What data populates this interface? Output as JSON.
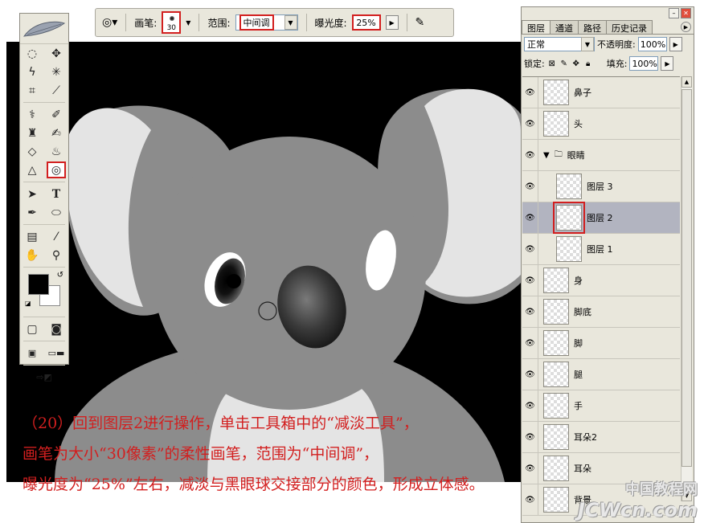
{
  "options_bar": {
    "brush_label": "画笔:",
    "brush_size": "30",
    "range_label": "范围:",
    "range_value": "中间调",
    "exposure_label": "曝光度:",
    "exposure_value": "25%"
  },
  "toolbox": {
    "tools": [
      "marquee-icon",
      "move-icon",
      "lasso-icon",
      "magic-wand-icon",
      "crop-icon",
      "slice-icon",
      "healing-brush-icon",
      "brush-icon",
      "clone-stamp-icon",
      "history-brush-icon",
      "eraser-icon",
      "paint-bucket-icon",
      "blur-icon",
      "dodge-icon",
      "path-select-icon",
      "type-icon",
      "pen-icon",
      "ellipse-shape-icon",
      "notes-icon",
      "eyedropper-icon",
      "hand-icon",
      "zoom-icon"
    ],
    "selected_tool": "dodge-icon",
    "foreground_color": "#000000",
    "background_color": "#ffffff"
  },
  "layers_panel": {
    "tabs": [
      "图层",
      "通道",
      "路径",
      "历史记录"
    ],
    "active_tab": "图层",
    "blend_mode": "正常",
    "opacity_label": "不透明度:",
    "opacity_value": "100%",
    "lock_label": "锁定:",
    "fill_label": "填充:",
    "fill_value": "100%",
    "layers": [
      {
        "name": "鼻子",
        "group_member": false
      },
      {
        "name": "头",
        "group_member": false
      },
      {
        "name": "眼睛",
        "group_member": false,
        "is_group": true
      },
      {
        "name": "图层 3",
        "group_member": true
      },
      {
        "name": "图层 2",
        "group_member": true,
        "selected": true
      },
      {
        "name": "图层 1",
        "group_member": true
      },
      {
        "name": "身",
        "group_member": false
      },
      {
        "name": "脚底",
        "group_member": false
      },
      {
        "name": "脚",
        "group_member": false
      },
      {
        "name": "腿",
        "group_member": false
      },
      {
        "name": "手",
        "group_member": false
      },
      {
        "name": "耳朵2",
        "group_member": false
      },
      {
        "name": "耳朵",
        "group_member": false
      },
      {
        "name": "背景",
        "group_member": false
      }
    ]
  },
  "caption": {
    "line1": "（20）回到图层2进行操作，单击工具箱中的“减淡工具”，",
    "line2": "画笔为大小“30像素”的柔性画笔，范围为“中间调”，",
    "line3": "曝光度为“25%”左右，减淡与黑眼球交接部分的颜色，形成立体感。"
  },
  "watermark": {
    "line1": "中国教程网",
    "line2": "JCWcn.com"
  },
  "colors": {
    "highlight_red": "#d21f1f",
    "panel_bg": "#e9e7dc",
    "koala_gray": "#8c8c8c"
  }
}
